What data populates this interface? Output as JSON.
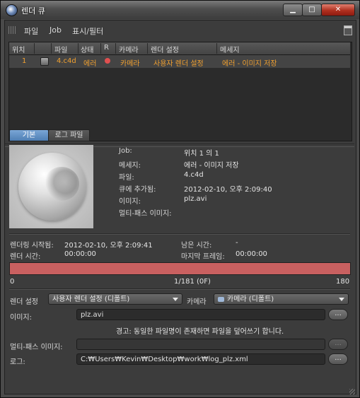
{
  "window": {
    "title": "렌더 큐",
    "min": "▁",
    "max": "□",
    "close": "✕"
  },
  "menu": {
    "file": "파일",
    "job": "Job",
    "view": "표시/필터"
  },
  "table": {
    "headers": {
      "pos": "위치",
      "file": "파일",
      "status": "상태",
      "r": "R",
      "camera": "카메라",
      "render_settings": "렌더 설정",
      "message": "메세지"
    },
    "rows": [
      {
        "pos": "1",
        "file": "4.c4d",
        "status": "에러",
        "camera": "카메라",
        "render_settings": "사용자 렌더 설정",
        "message": "에러 - 이미지 저장"
      }
    ]
  },
  "tabs": {
    "basic": "기본",
    "log": "로그 파일"
  },
  "info": {
    "job_label": "Job:",
    "job_value": "위치 1 의 1",
    "message_label": "메세지:",
    "message_value": "에러 - 이미지 저장",
    "file_label": "파일:",
    "file_value": "4.c4d",
    "queued_label": "큐에 추가됨:",
    "queued_value": "2012-02-10, 오후 2:09:40",
    "image_label": "이미지:",
    "image_value": "plz.avi",
    "multipass_label": "멀티-패스 이미지:",
    "multipass_value": ""
  },
  "render": {
    "started_label": "렌더링 시작됨:",
    "started_value": "2012-02-10, 오후 2:09:41",
    "remaining_label": "남은 시간:",
    "remaining_value": "-",
    "render_time_label": "렌더 시간:",
    "render_time_value": "00:00:00",
    "last_frame_label": "마지막 프레임:",
    "last_frame_value": "00:00:00"
  },
  "progress": {
    "start": "0",
    "middle": "1/181 (0F)",
    "end": "180",
    "fraction": 1.0,
    "color": "#c96060"
  },
  "settings": {
    "render_settings_label": "렌더 설정",
    "render_settings_value": "사용자 렌더 설정 (디폴트)",
    "camera_label": "카메라",
    "camera_value": "카메라 (디폴트)",
    "image_label": "이미지:",
    "image_value": "plz.avi",
    "warning": "경고: 동일한 파일명이 존재하면 파일을 덮어쓰기 합니다.",
    "multipass_label": "멀티-패스 이미지:",
    "multipass_value": "",
    "log_label": "로그:",
    "log_value": "C:₩Users₩Kevin₩Desktop₩work₩log_plz.xml",
    "browse": "..."
  },
  "colors": {
    "accent": "#4f7fb4",
    "error_text": "#f0a030",
    "error_dot": "#e05050"
  }
}
